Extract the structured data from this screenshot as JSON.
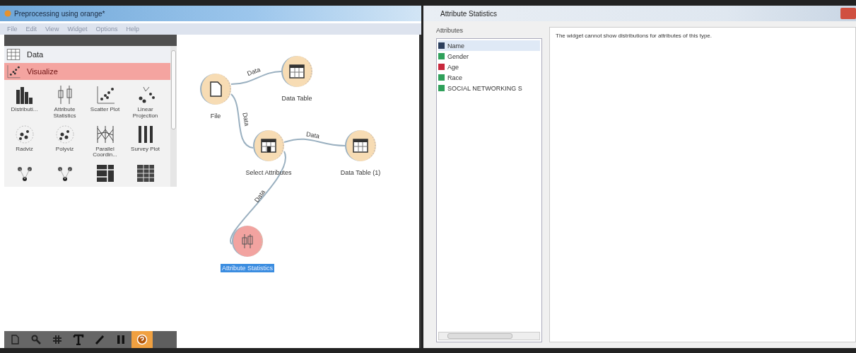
{
  "window": {
    "title": "Preprocessing using orange*"
  },
  "menu": [
    "File",
    "Edit",
    "View",
    "Widget",
    "Options",
    "Help"
  ],
  "toolbox": {
    "categories": [
      {
        "label": "Data",
        "selected": false,
        "kind": "table"
      },
      {
        "label": "Visualize",
        "selected": true,
        "kind": "scatter"
      }
    ],
    "widgets": [
      {
        "label": "Distributi...",
        "kind": "histogram"
      },
      {
        "label": "Attribute Statistics",
        "kind": "boxplot"
      },
      {
        "label": "Scatter Plot",
        "kind": "scatter"
      },
      {
        "label": "Linear Projection",
        "kind": "projection"
      },
      {
        "label": "Radviz",
        "kind": "radviz"
      },
      {
        "label": "Polyviz",
        "kind": "polyviz"
      },
      {
        "label": "Parallel Coordin...",
        "kind": "parallel"
      },
      {
        "label": "Survey Plot",
        "kind": "survey"
      },
      {
        "kind": "cluster"
      },
      {
        "kind": "cluster"
      },
      {
        "kind": "mosaic"
      },
      {
        "kind": "sieve"
      }
    ]
  },
  "canvas": {
    "nodes": [
      {
        "label": "File",
        "kind": "file",
        "color": "#f7dcb4",
        "selected": false
      },
      {
        "label": "Data Table",
        "kind": "table",
        "color": "#f7dcb4",
        "selected": false
      },
      {
        "label": "Select Attributes",
        "kind": "select",
        "color": "#f7dcb4",
        "selected": false
      },
      {
        "label": "Data Table (1)",
        "kind": "table",
        "color": "#f7dcb4",
        "selected": false
      },
      {
        "label": "Attribute Statistics",
        "kind": "stats",
        "color": "#f2a3a0",
        "selected": true
      }
    ],
    "links": [
      {
        "label": "Data"
      },
      {
        "label": "Data"
      },
      {
        "label": "Data"
      },
      {
        "label": "Data"
      }
    ]
  },
  "tools": [
    {
      "kind": "document",
      "selected": false
    },
    {
      "kind": "search",
      "selected": false
    },
    {
      "kind": "grid",
      "selected": false
    },
    {
      "kind": "text",
      "selected": false
    },
    {
      "kind": "pen",
      "selected": false
    },
    {
      "kind": "pause",
      "selected": false
    },
    {
      "kind": "help",
      "selected": true
    }
  ],
  "stats_window": {
    "title": "Attribute Statistics",
    "group": "Attributes",
    "attributes": [
      {
        "label": "Name",
        "color": "#2b3e5c",
        "selected": true
      },
      {
        "label": "Gender",
        "color": "#2fa05a",
        "selected": false
      },
      {
        "label": "Age",
        "color": "#c8283c",
        "selected": false
      },
      {
        "label": "Race",
        "color": "#2fa05a",
        "selected": false
      },
      {
        "label": "SOCIAL NETWORKING S",
        "color": "#2fa05a",
        "selected": false
      }
    ],
    "message": "The widget cannot show distributions for attributes of this type."
  }
}
